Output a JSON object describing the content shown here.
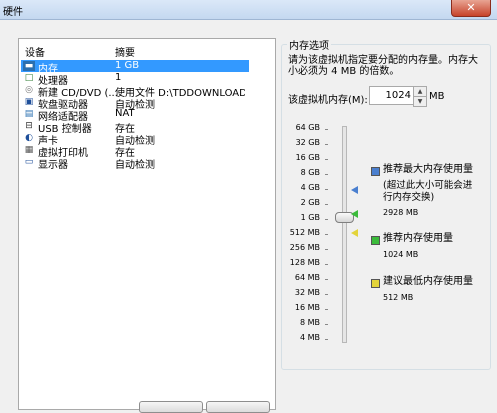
{
  "window": {
    "title": "硬件",
    "close_glyph": "✕"
  },
  "devices": {
    "header_device": "设备",
    "header_summary": "摘要",
    "rows": [
      {
        "icon": "memory-icon",
        "glyph": "▬",
        "name": "内存",
        "summary": "1 GB"
      },
      {
        "icon": "processor-icon",
        "glyph": "□",
        "name": "处理器",
        "summary": "1"
      },
      {
        "icon": "cd-dvd-icon",
        "glyph": "◎",
        "name": "新建 CD/DVD (...",
        "summary": "使用文件 D:\\TDDOWNLOAD..."
      },
      {
        "icon": "floppy-icon",
        "glyph": "▣",
        "name": "软盘驱动器",
        "summary": "自动检测"
      },
      {
        "icon": "network-adapter-icon",
        "glyph": "▤",
        "name": "网络适配器",
        "summary": "NAT"
      },
      {
        "icon": "usb-icon",
        "glyph": "⊟",
        "name": "USB 控制器",
        "summary": "存在"
      },
      {
        "icon": "sound-icon",
        "glyph": "◐",
        "name": "声卡",
        "summary": "自动检测"
      },
      {
        "icon": "printer-icon",
        "glyph": "▦",
        "name": "虚拟打印机",
        "summary": "存在"
      },
      {
        "icon": "display-icon",
        "glyph": "▭",
        "name": "显示器",
        "summary": "自动检测"
      }
    ]
  },
  "memory": {
    "group_title": "内存选项",
    "description": "请为该虚拟机指定要分配的内存量。内存大小必须为 4 MB 的倍数。",
    "field_label": "该虚拟机内存(M):",
    "value": "1024",
    "unit": "MB",
    "spin_up": "▲",
    "spin_down": "▼",
    "scale_labels": [
      "64 GB",
      "32 GB",
      "16 GB",
      "8 GB",
      "4 GB",
      "2 GB",
      "1 GB",
      "512 MB",
      "256 MB",
      "128 MB",
      "64 MB",
      "32 MB",
      "16 MB",
      "8 MB",
      "4 MB"
    ],
    "slider_value": "1 GB",
    "legend": {
      "max_title": "推荐最大内存使用量",
      "max_note": "(超过此大小可能会进行内存交换)",
      "max_value": "2928 MB",
      "rec_title": "推荐内存使用量",
      "rec_value": "1024 MB",
      "min_title": "建议最低内存使用量",
      "min_value": "512 MB"
    },
    "colors": {
      "max": "#4a7fcf",
      "recommended": "#3bbb3b",
      "minimum": "#e3d43b"
    }
  }
}
